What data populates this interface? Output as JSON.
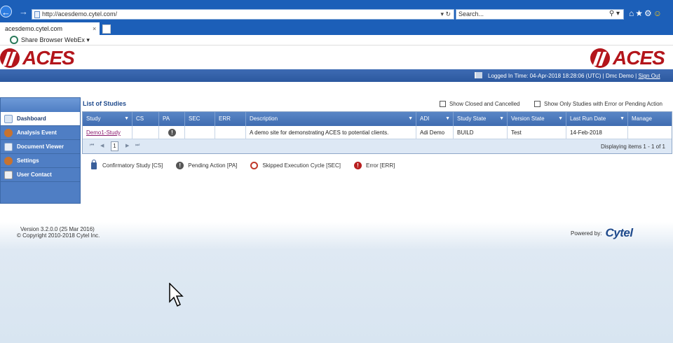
{
  "browser": {
    "url": "http://acesdemo.cytel.com/",
    "search_placeholder": "Search...",
    "tab_title": "acesdemo.cytel.com",
    "favorites": "Share Browser  WebEx ▾"
  },
  "app": {
    "logo_text": "ACES",
    "login_info": "Logged In Time: 04-Apr-2018 18:28:06 (UTC) | Dmc Demo | ",
    "sign_out": "Sign Out"
  },
  "sidebar": {
    "items": [
      {
        "label": "Dashboard",
        "icon": "dashboard-icon"
      },
      {
        "label": "Analysis Event",
        "icon": "person-icon"
      },
      {
        "label": "Document Viewer",
        "icon": "document-icon"
      },
      {
        "label": "Settings",
        "icon": "settings-person-icon"
      },
      {
        "label": "User Contact",
        "icon": "contact-card-icon"
      }
    ]
  },
  "main": {
    "title": "List of Studies",
    "show_closed": "Show Closed and Cancelled",
    "show_errors": "Show Only Studies with Error or Pending Action"
  },
  "grid": {
    "columns": [
      "Study",
      "CS",
      "PA",
      "SEC",
      "ERR",
      "Description",
      "ADI",
      "Study State",
      "Version State",
      "Last Run Date",
      "Manage"
    ],
    "rows": [
      {
        "study": "Demo1-Study",
        "cs": "",
        "pa": "!",
        "sec": "",
        "err": "",
        "description": "A demo site for demonstrating ACES to potential clients.",
        "adi": "Adi Demo",
        "study_state": "BUILD",
        "version_state": "Test",
        "last_run_date": "14-Feb-2018",
        "manage": ""
      }
    ],
    "page": "1",
    "displaying": "Displaying items 1 - 1 of 1"
  },
  "legend": {
    "cs": "Confirmatory Study [CS]",
    "pa": "Pending Action [PA]",
    "sec": "Skipped Execution Cycle [SEC]",
    "err": "Error [ERR]"
  },
  "footer": {
    "version": "Version 3.2.0.0 (25 Mar 2016)",
    "copyright": "© Copyright 2010-2018 Cytel Inc.",
    "powered_by": "Powered by:",
    "brand": "Cytel"
  },
  "colors": {
    "brand_red": "#b3151b",
    "header_blue": "#2c589f",
    "sidebar_blue": "#4f7ec4"
  }
}
